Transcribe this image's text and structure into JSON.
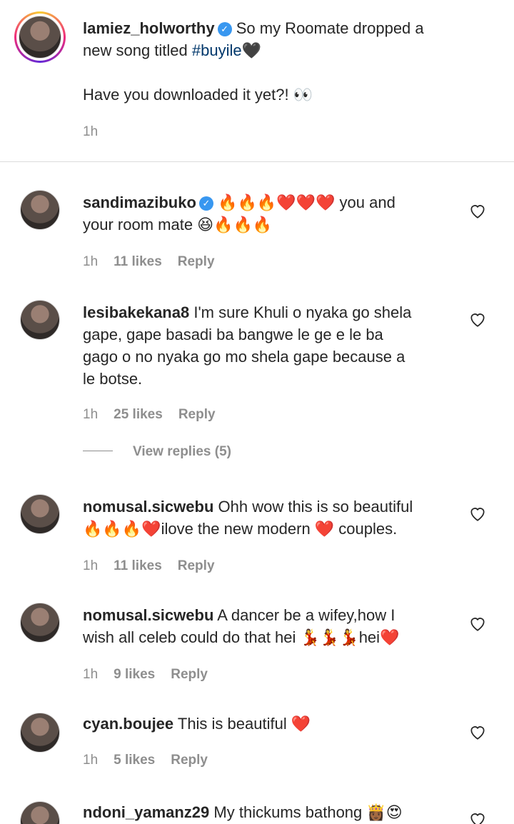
{
  "post": {
    "username": "lamiez_holworthy",
    "caption_line1": "So my Roomate dropped a",
    "caption_line2a": "new song titled ",
    "hashtag": "#buyile",
    "caption_line2b": "🖤",
    "caption_line3": "Have you downloaded it yet?! 👀",
    "time": "1h"
  },
  "comments": [
    {
      "username": "sandimazibuko",
      "verified": true,
      "lines": [
        "🔥🔥🔥❤️❤️❤️ you and",
        "your room mate 😆🔥🔥🔥"
      ],
      "time": "1h",
      "likes": "11 likes",
      "reply": "Reply"
    },
    {
      "username": "lesibakekana8",
      "verified": false,
      "lines": [
        "I'm sure Khuli o nyaka go shela",
        "gape, gape basadi ba bangwe le ge e le ba",
        "gago o no nyaka go mo shela gape because a",
        "le botse."
      ],
      "time": "1h",
      "likes": "25 likes",
      "reply": "Reply",
      "view_replies": "View replies (5)"
    },
    {
      "username": "nomusal.sicwebu",
      "verified": false,
      "lines": [
        "Ohh wow this is so beautiful",
        "🔥🔥🔥❤️ilove the new modern ❤️ couples."
      ],
      "time": "1h",
      "likes": "11 likes",
      "reply": "Reply"
    },
    {
      "username": "nomusal.sicwebu",
      "verified": false,
      "lines": [
        "A dancer be a wifey,how I",
        "wish all celeb could do that hei 💃💃💃hei❤️"
      ],
      "time": "1h",
      "likes": "9 likes",
      "reply": "Reply"
    },
    {
      "username": "cyan.boujee",
      "verified": false,
      "lines": [
        "This is beautiful ❤️"
      ],
      "time": "1h",
      "likes": "5 likes",
      "reply": "Reply"
    },
    {
      "username": "ndoni_yamanz29",
      "verified": false,
      "lines": [
        "My thickums bathong 👸🏾😍"
      ],
      "time": "",
      "likes": "",
      "reply": ""
    }
  ],
  "colors": {
    "verified": "#3897f0",
    "hashtag": "#00376b",
    "meta": "#8e8e8e"
  },
  "icons": {
    "like": "heart-outline-icon",
    "verified": "verified-badge-icon"
  }
}
